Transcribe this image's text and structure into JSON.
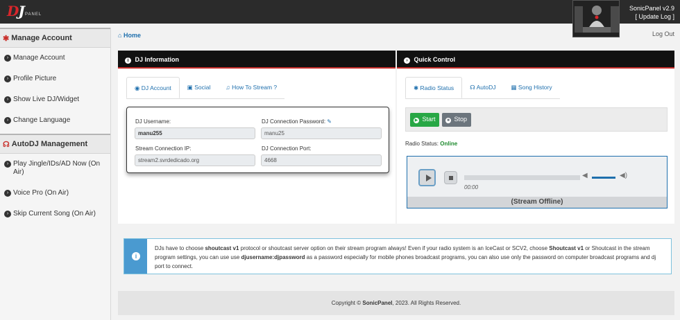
{
  "topbar": {
    "logo_main": "DJ",
    "logo_sub": "PANEL",
    "brand_name": "SonicPanel v2.9",
    "update_log": "[ Update Log ]"
  },
  "sidebar": {
    "sections": [
      {
        "title": "Manage Account",
        "icon": "gear-icon",
        "items": [
          "Manage Account",
          "Profile Picture",
          "Show Live DJ/Widget",
          "Change Language"
        ]
      },
      {
        "title": "AutoDJ Management",
        "icon": "headphones-icon",
        "items": [
          "Play Jingle/IDs/AD Now (On Air)",
          "Voice Pro (On Air)",
          "Skip Current Song (On Air)"
        ]
      }
    ]
  },
  "breadcrumb": "Home",
  "logout": "Log Out",
  "dj_info": {
    "title": "DJ Information",
    "tabs": [
      "DJ Account",
      "Social",
      "How To Stream ?"
    ],
    "fields": {
      "username_label": "DJ Username:",
      "username_value": "manu255",
      "password_label": "DJ Connection Password:",
      "password_value": "manu25",
      "ip_label": "Stream Connection IP:",
      "ip_value": "stream2.svrdedicado.org",
      "port_label": "DJ Connection Port:",
      "port_value": "4668"
    }
  },
  "quick_control": {
    "title": "Quick Control",
    "tabs": [
      "Radio Status",
      "AutoDJ",
      "Song History"
    ],
    "start_label": "Start",
    "stop_label": "Stop",
    "status_label": "Radio Status:",
    "status_value": "Online",
    "player_time": "00:00",
    "player_volume": 1.0,
    "player_status": "(Stream Offline)"
  },
  "info": {
    "t1": "DJs have to choose ",
    "b1": "shoutcast v1",
    "t2": " protocol or shoutcast server option on their stream program always! Even if your radio system is an IceCast or SCV2, choose ",
    "b2": "Shoutcast v1",
    "t3": " or Shoutcast in the stream program settings, you can use use ",
    "b3": "djusername:djpassword",
    "t4": " as a password especially for mobile phones broadcast programs, you can also use only the password on computer broadcast programs and dj port to connect."
  },
  "footer": {
    "prefix": "Copyright © ",
    "brand": "SonicPanel",
    "suffix": ", 2023. All Rights Reserved."
  },
  "colors": {
    "accent_red": "#c9302c",
    "link_blue": "#1e6fad",
    "start_green": "#28a745",
    "stop_gray": "#6c757d",
    "online_green": "#1e8a2e",
    "info_blue": "#4a9ad0"
  }
}
